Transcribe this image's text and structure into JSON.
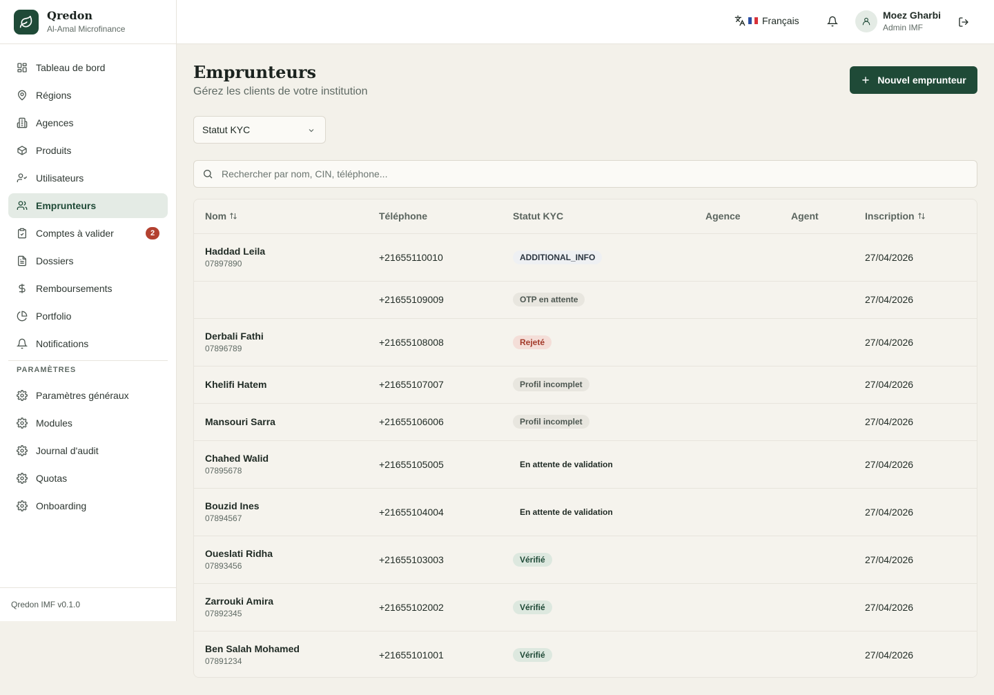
{
  "brand": {
    "name": "Qredon",
    "subtitle": "Al-Amal Microfinance"
  },
  "nav": {
    "items": [
      {
        "label": "Tableau de bord",
        "icon": "dashboard-icon"
      },
      {
        "label": "Régions",
        "icon": "map-pin-icon"
      },
      {
        "label": "Agences",
        "icon": "building-icon"
      },
      {
        "label": "Produits",
        "icon": "package-icon"
      },
      {
        "label": "Utilisateurs",
        "icon": "user-check-icon"
      },
      {
        "label": "Emprunteurs",
        "icon": "users-icon",
        "active": true
      },
      {
        "label": "Comptes à valider",
        "icon": "clipboard-check-icon",
        "badge": "2"
      },
      {
        "label": "Dossiers",
        "icon": "file-text-icon"
      },
      {
        "label": "Remboursements",
        "icon": "dollar-icon"
      },
      {
        "label": "Portfolio",
        "icon": "pie-chart-icon"
      },
      {
        "label": "Notifications",
        "icon": "bell-icon"
      }
    ],
    "settings_title": "PARAMÈTRES",
    "settings": [
      {
        "label": "Paramètres généraux",
        "icon": "gear-icon"
      },
      {
        "label": "Modules",
        "icon": "gear-icon"
      },
      {
        "label": "Journal d'audit",
        "icon": "gear-icon"
      },
      {
        "label": "Quotas",
        "icon": "gear-icon"
      },
      {
        "label": "Onboarding",
        "icon": "gear-icon"
      }
    ],
    "version": "Qredon IMF v0.1.0"
  },
  "topbar": {
    "language": "Français",
    "user_name": "Moez Gharbi",
    "user_role": "Admin IMF"
  },
  "page": {
    "title": "Emprunteurs",
    "subtitle": "Gérez les clients de votre institution",
    "new_button": "Nouvel emprunteur",
    "kyc_filter": "Statut KYC",
    "search_placeholder": "Rechercher par nom, CIN, téléphone..."
  },
  "table": {
    "columns": [
      "Nom",
      "Téléphone",
      "Statut KYC",
      "Agence",
      "Agent",
      "Inscription"
    ],
    "rows": [
      {
        "name": "Haddad Leila",
        "cin": "07897890",
        "phone": "+21655110010",
        "kyc": "ADDITIONAL_INFO",
        "kyc_style": "info",
        "date": "27/04/2026"
      },
      {
        "name": "",
        "cin": "",
        "phone": "+21655109009",
        "kyc": "OTP en attente",
        "kyc_style": "gray",
        "date": "27/04/2026"
      },
      {
        "name": "Derbali Fathi",
        "cin": "07896789",
        "phone": "+21655108008",
        "kyc": "Rejeté",
        "kyc_style": "red",
        "date": "27/04/2026"
      },
      {
        "name": "Khelifi Hatem",
        "cin": "",
        "phone": "+21655107007",
        "kyc": "Profil incomplet",
        "kyc_style": "gray",
        "date": "27/04/2026"
      },
      {
        "name": "Mansouri Sarra",
        "cin": "",
        "phone": "+21655106006",
        "kyc": "Profil incomplet",
        "kyc_style": "gray",
        "date": "27/04/2026"
      },
      {
        "name": "Chahed Walid",
        "cin": "07895678",
        "phone": "+21655105005",
        "kyc": "En attente de validation",
        "kyc_style": "plain",
        "date": "27/04/2026"
      },
      {
        "name": "Bouzid Ines",
        "cin": "07894567",
        "phone": "+21655104004",
        "kyc": "En attente de validation",
        "kyc_style": "plain",
        "date": "27/04/2026"
      },
      {
        "name": "Oueslati Ridha",
        "cin": "07893456",
        "phone": "+21655103003",
        "kyc": "Vérifié",
        "kyc_style": "green",
        "date": "27/04/2026"
      },
      {
        "name": "Zarrouki Amira",
        "cin": "07892345",
        "phone": "+21655102002",
        "kyc": "Vérifié",
        "kyc_style": "green",
        "date": "27/04/2026"
      },
      {
        "name": "Ben Salah Mohamed",
        "cin": "07891234",
        "phone": "+21655101001",
        "kyc": "Vérifié",
        "kyc_style": "green",
        "date": "27/04/2026"
      }
    ]
  },
  "colors": {
    "brand": "#1f4a37",
    "danger": "#b34130",
    "background": "#f3f1ea"
  }
}
